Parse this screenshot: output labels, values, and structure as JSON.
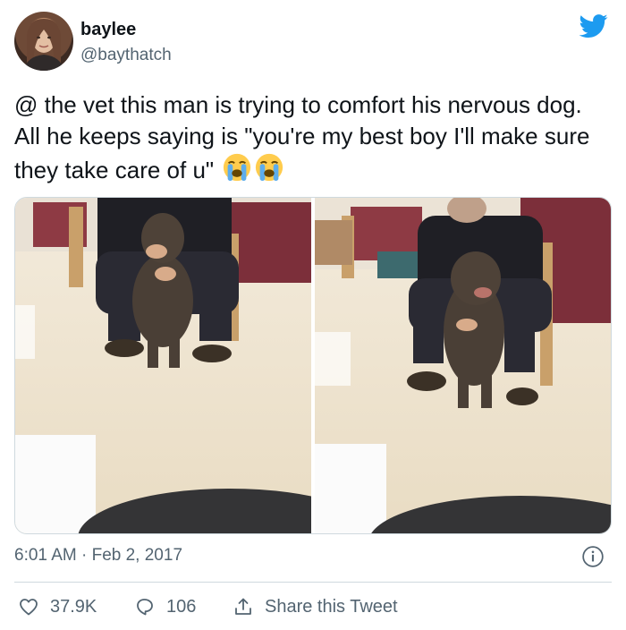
{
  "author": {
    "name": "baylee",
    "handle": "@baythatch"
  },
  "tweet": {
    "text": "@ the vet this man is trying to comfort his nervous dog. All he keeps saying is \"you're my best boy I'll make sure they take care of u\"",
    "emojis": [
      "loudly-crying-face",
      "loudly-crying-face"
    ],
    "timestamp": "6:01 AM · Feb 2, 2017"
  },
  "actions": {
    "likes": "37.9K",
    "replies": "106",
    "share_label": "Share this Tweet"
  },
  "colors": {
    "twitter_blue": "#1d9bf0",
    "secondary_text": "#536471",
    "border": "#cfd9de"
  }
}
